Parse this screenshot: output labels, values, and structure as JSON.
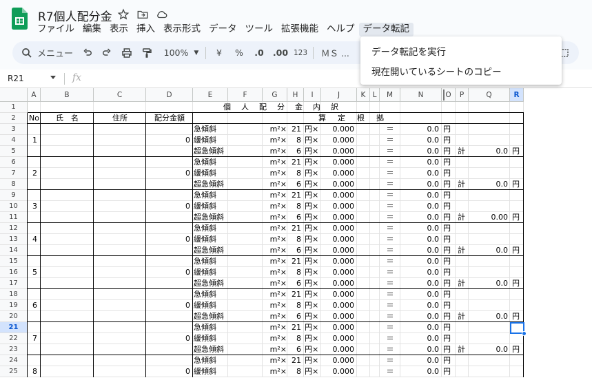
{
  "doc": {
    "title": "R7個人配分金"
  },
  "menus": [
    "ファイル",
    "編集",
    "表示",
    "挿入",
    "表示形式",
    "データ",
    "ツール",
    "拡張機能",
    "ヘルプ",
    "データ転記"
  ],
  "toolbar": {
    "menu_search": "メニュー",
    "zoom": "100%",
    "currency": "¥",
    "percent": "%",
    "dec_decrease": ".0",
    "dec_increase": ".00",
    "format_123": "123",
    "font": "ＭＳ ..."
  },
  "dropdown": {
    "items": [
      "データ転記を実行",
      "現在開いているシートのコピー"
    ]
  },
  "formula_bar": {
    "name_box": "R21",
    "fx": "fx",
    "formula": ""
  },
  "selected": {
    "row": "21",
    "col": "R"
  },
  "columns": [
    "A",
    "B",
    "C",
    "D",
    "E",
    "F",
    "G",
    "H",
    "I",
    "J",
    "K",
    "L",
    "M",
    "N",
    "O",
    "P",
    "Q",
    "R"
  ],
  "rows": [
    "1",
    "2",
    "3",
    "4",
    "5",
    "6",
    "7",
    "8",
    "9",
    "10",
    "11",
    "12",
    "13",
    "14",
    "15",
    "16",
    "17",
    "18",
    "19",
    "20",
    "21",
    "22",
    "23",
    "24",
    "25"
  ],
  "sheet": {
    "title": "個　人　配　分　金　内　訳",
    "headers": {
      "no": "No",
      "name": "氏　名",
      "address": "住所",
      "amount": "配分金額",
      "basis": "算　定　根　拠"
    },
    "slope_types": [
      "急傾斜",
      "緩傾斜",
      "超急傾斜"
    ],
    "unit_m2": "m²×",
    "unit_yen_x": "円×",
    "equals": "＝",
    "yen": "円",
    "total_label": "計",
    "rates": [
      "21",
      "8",
      "6"
    ],
    "factor": "0.000",
    "line_amount": "0.0",
    "groups": [
      {
        "no": "1",
        "amount": "0",
        "total": "0.0"
      },
      {
        "no": "2",
        "amount": "0",
        "total": "0.0"
      },
      {
        "no": "3",
        "amount": "0",
        "total": "0.00"
      },
      {
        "no": "4",
        "amount": "0",
        "total": "0.0"
      },
      {
        "no": "5",
        "amount": "0",
        "total": "0.0"
      },
      {
        "no": "6",
        "amount": "0",
        "total": "0.0"
      },
      {
        "no": "7",
        "amount": "0",
        "total": "0.0"
      },
      {
        "no": "8",
        "amount": "0",
        "total": ""
      }
    ]
  }
}
